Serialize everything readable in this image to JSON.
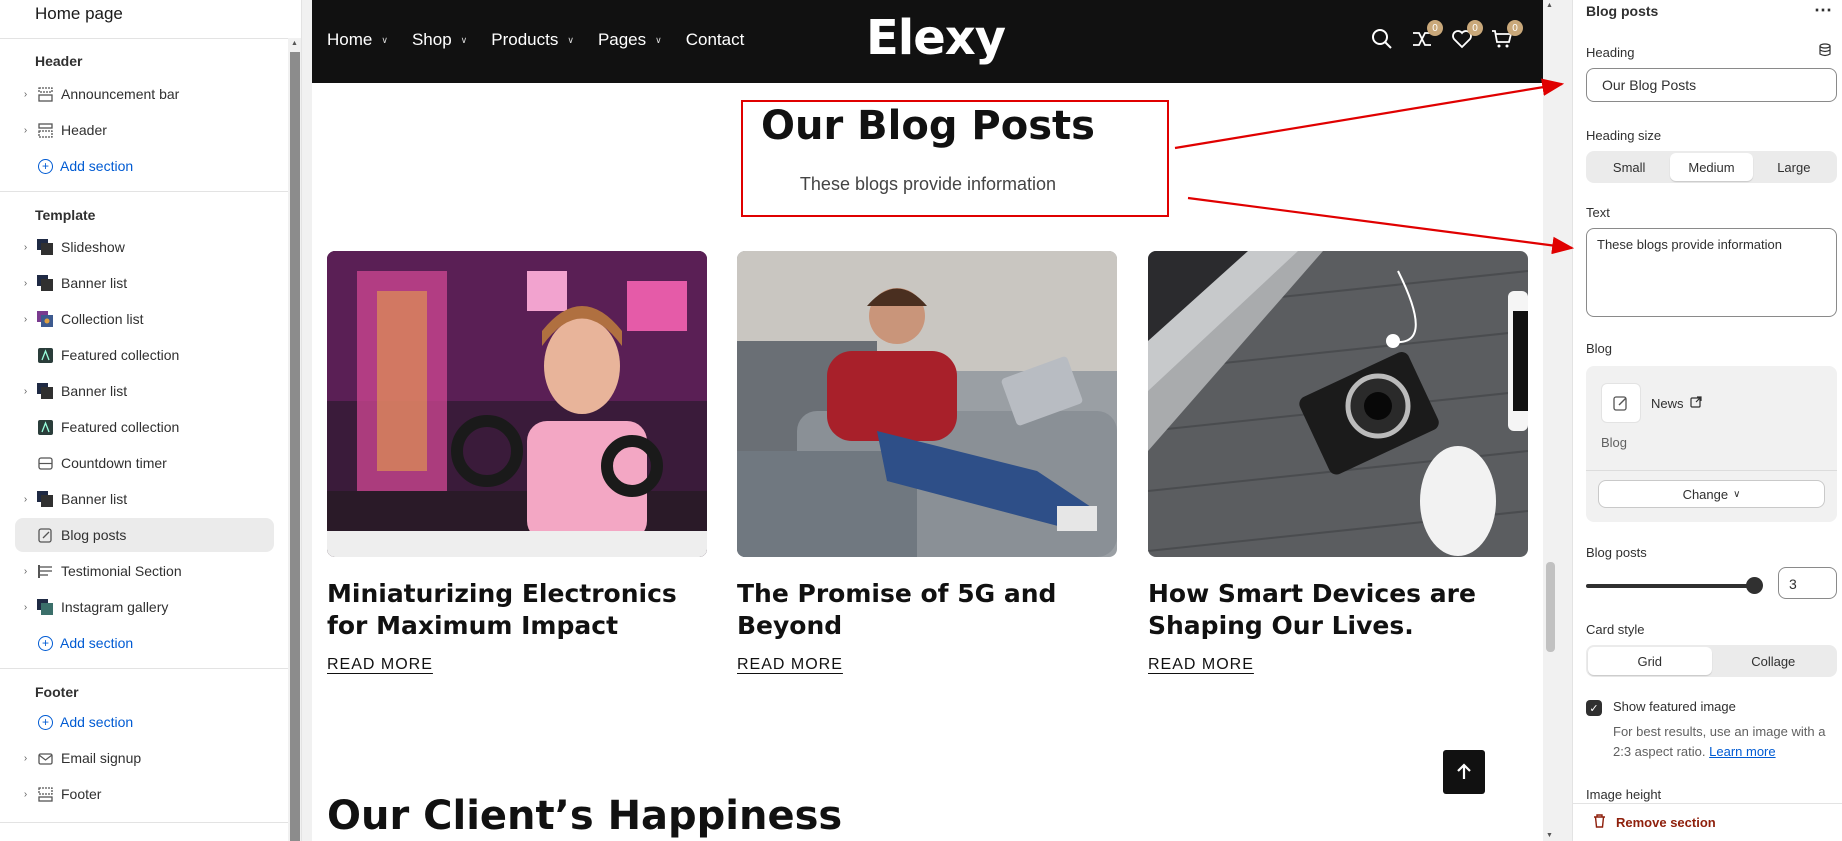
{
  "sidebar": {
    "title": "Home page",
    "header_group": "Header",
    "header_items": [
      {
        "label": "Announcement bar"
      },
      {
        "label": "Header"
      }
    ],
    "add_section": "Add section",
    "template_group": "Template",
    "template_items": [
      {
        "label": "Slideshow",
        "icon": "slideshow-icon"
      },
      {
        "label": "Banner list",
        "icon": "banner-icon"
      },
      {
        "label": "Collection list",
        "icon": "collection-icon"
      },
      {
        "label": "Featured collection",
        "icon": "featured-icon"
      },
      {
        "label": "Banner list",
        "icon": "banner-icon"
      },
      {
        "label": "Featured collection",
        "icon": "featured-icon"
      },
      {
        "label": "Countdown timer",
        "icon": "timer-icon"
      },
      {
        "label": "Banner list",
        "icon": "banner-icon"
      },
      {
        "label": "Blog posts",
        "icon": "blog-icon"
      },
      {
        "label": "Testimonial Section",
        "icon": "testimonial-icon"
      },
      {
        "label": "Instagram gallery",
        "icon": "gallery-icon"
      }
    ],
    "footer_group": "Footer",
    "footer_items": [
      {
        "label": "Email signup"
      },
      {
        "label": "Footer"
      }
    ]
  },
  "store": {
    "nav": [
      "Home",
      "Shop",
      "Products",
      "Pages",
      "Contact"
    ],
    "logo": "Elexy",
    "badges": {
      "compare": "0",
      "wishlist": "0",
      "cart": "0"
    },
    "blog_heading": "Our Blog Posts",
    "blog_subtitle": "These blogs provide information",
    "cards": [
      {
        "title": "Miniaturizing Electronics for Maximum Impact",
        "read_more": "READ MORE"
      },
      {
        "title": "The Promise of 5G and Beyond",
        "read_more": "READ MORE"
      },
      {
        "title": "How Smart Devices are Shaping Our Lives.",
        "read_more": "READ MORE"
      }
    ],
    "next_heading": "Our Client’s Happiness"
  },
  "panel": {
    "title": "Blog posts",
    "heading_label": "Heading",
    "heading_value": "Our Blog Posts",
    "heading_size_label": "Heading size",
    "heading_sizes": [
      "Small",
      "Medium",
      "Large"
    ],
    "heading_size_selected": "Medium",
    "text_label": "Text",
    "text_value": "These blogs provide information",
    "blog_label": "Blog",
    "blog_name": "News",
    "blog_type": "Blog",
    "change_label": "Change",
    "blog_posts_label": "Blog posts",
    "blog_posts_value": "3",
    "card_style_label": "Card style",
    "card_styles": [
      "Grid",
      "Collage"
    ],
    "card_style_selected": "Grid",
    "show_featured_label": "Show featured image",
    "show_featured_checked": true,
    "help_text": "For best results, use an image with a 2:3 aspect ratio.",
    "help_link": "Learn more",
    "image_height_label": "Image height",
    "remove_label": "Remove section"
  },
  "colors": {
    "accent_link": "#005bd3",
    "nav_bg": "#111111",
    "badge": "#c9a87a",
    "annotation": "#e00000",
    "remove": "#8e1f0b"
  }
}
